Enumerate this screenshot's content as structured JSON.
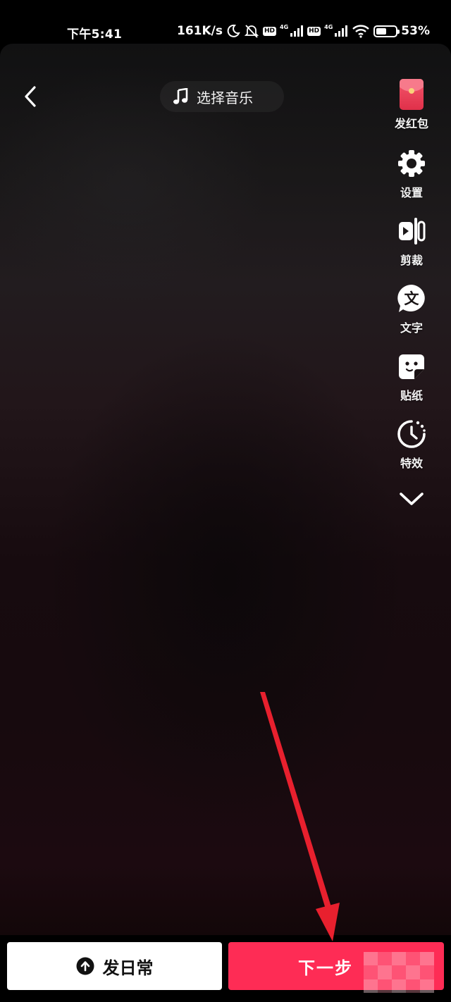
{
  "status_bar": {
    "time": "下午5:41",
    "network_speed": "161K/s",
    "hd_badge_1": "HD",
    "hd_badge_2": "HD",
    "net_type_1": "4G",
    "net_type_2": "4G",
    "battery_percent": "53%",
    "battery_level": 0.53,
    "icons": [
      "moon-icon",
      "mute-icon",
      "signal-icon",
      "wifi-icon",
      "battery-icon"
    ]
  },
  "header": {
    "back_icon": "chevron-left-icon",
    "music_icon": "music-note-icon",
    "music_label": "选择音乐"
  },
  "toolbar": {
    "items": [
      {
        "label": "发红包",
        "icon": "red-packet-icon"
      },
      {
        "label": "设置",
        "icon": "gear-icon"
      },
      {
        "label": "剪裁",
        "icon": "trim-icon"
      },
      {
        "label": "文字",
        "icon": "text-bubble-icon",
        "glyph": "文"
      },
      {
        "label": "贴纸",
        "icon": "sticker-icon"
      },
      {
        "label": "特效",
        "icon": "effects-timer-icon"
      }
    ],
    "more_icon": "chevron-down-icon"
  },
  "bottom": {
    "daily_label": "发日常",
    "daily_icon": "upload-arrow-icon",
    "next_label": "下一步"
  },
  "colors": {
    "accent": "#fe2c55",
    "annotation_arrow": "#e8202e",
    "background": "#000000"
  }
}
